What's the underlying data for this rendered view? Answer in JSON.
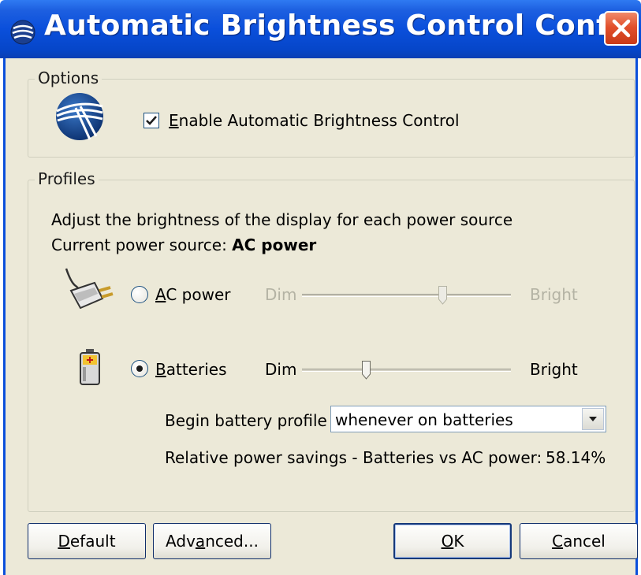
{
  "window": {
    "title": "Automatic Brightness Control Config...",
    "title_icon": "brightness-app-icon",
    "close_icon": "close-icon"
  },
  "options": {
    "group_label": "Options",
    "logo_icon": "intel-logo-icon",
    "enable_checked": true,
    "enable_label_accel": "E",
    "enable_label_rest": "nable Automatic Brightness Control"
  },
  "profiles": {
    "group_label": "Profiles",
    "description": "Adjust the brightness of the display for each power source",
    "current_source_label": "Current power source:",
    "current_source_value": "AC power",
    "ac": {
      "icon": "ac-plug-icon",
      "selected": false,
      "label_accel": "A",
      "label_rest": "C power",
      "dim_label": "Dim",
      "bright_label": "Bright",
      "slider_level_percent": 68,
      "enabled": false
    },
    "batteries": {
      "icon": "battery-icon",
      "selected": true,
      "label_accel": "B",
      "label_rest": "atteries",
      "dim_label": "Dim",
      "bright_label": "Bright",
      "slider_level_percent": 30,
      "enabled": true
    },
    "begin_profile_label": "Begin battery profile",
    "begin_profile_value": "whenever on batteries",
    "savings_label": "Relative power savings - Batteries vs AC power:",
    "savings_value": "58.14%"
  },
  "buttons": {
    "default_accel": "D",
    "default_rest": "efault",
    "advanced_pre": "Adv",
    "advanced_accel": "a",
    "advanced_rest": "nced...",
    "ok_accel": "O",
    "ok_rest": "K",
    "cancel_accel": "C",
    "cancel_rest": "ancel"
  },
  "colors": {
    "titlebar": "#0a4fdb",
    "dialog_bg": "#ece9d8",
    "close_button": "#e2502c"
  }
}
